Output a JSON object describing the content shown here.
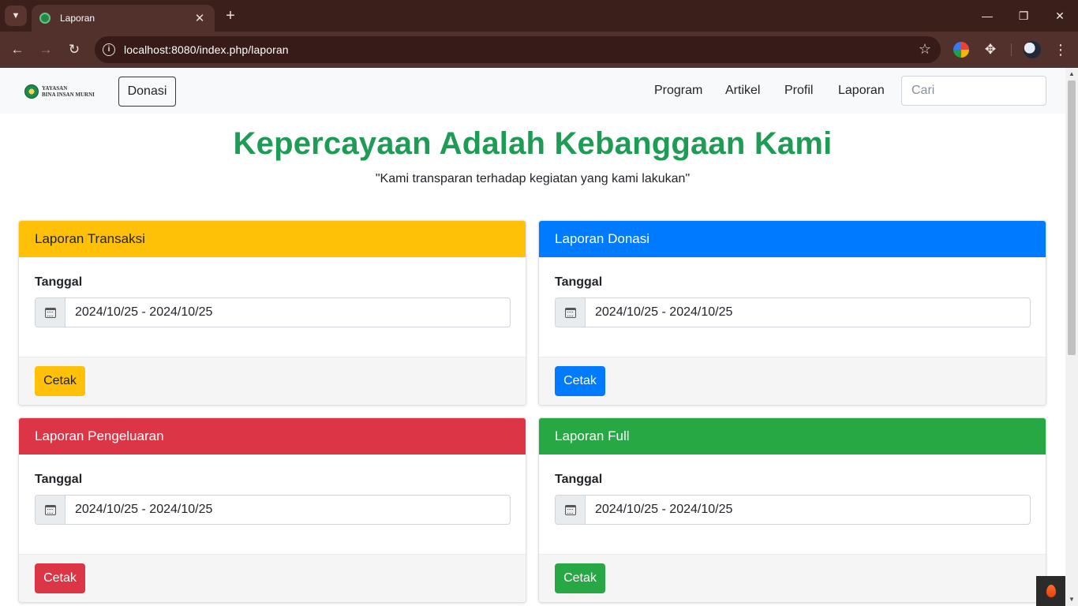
{
  "browser": {
    "tab_title": "Laporan",
    "url": "localhost:8080/index.php/laporan",
    "new_tab_glyph": "+",
    "tab_close_glyph": "✕"
  },
  "navbar": {
    "brand_line1": "YAYASAN",
    "brand_line2": "BINA INSAN MURNI",
    "donasi_label": "Donasi",
    "links": [
      "Program",
      "Artikel",
      "Profil",
      "Laporan"
    ],
    "search_placeholder": "Cari"
  },
  "hero": {
    "title": "Kepercayaan Adalah Kebanggaan Kami",
    "subtitle": "\"Kami transparan terhadap kegiatan yang kami lakukan\""
  },
  "cards": [
    {
      "title": "Laporan Transaksi",
      "label": "Tanggal",
      "date_range": "2024/10/25 - 2024/10/25",
      "button": "Cetak",
      "color": "#ffc107",
      "text_color": "#212529"
    },
    {
      "title": "Laporan Donasi",
      "label": "Tanggal",
      "date_range": "2024/10/25 - 2024/10/25",
      "button": "Cetak",
      "color": "#007bff",
      "text_color": "#ffffff"
    },
    {
      "title": "Laporan Pengeluaran",
      "label": "Tanggal",
      "date_range": "2024/10/25 - 2024/10/25",
      "button": "Cetak",
      "color": "#dc3545",
      "text_color": "#ffffff"
    },
    {
      "title": "Laporan Full",
      "label": "Tanggal",
      "date_range": "2024/10/25 - 2024/10/25",
      "button": "Cetak",
      "color": "#28a745",
      "text_color": "#ffffff"
    }
  ],
  "theme": {
    "hero_color": "#1e9b55",
    "chrome_dark": "#3b1f1b",
    "chrome_toolbar": "#52302b"
  }
}
